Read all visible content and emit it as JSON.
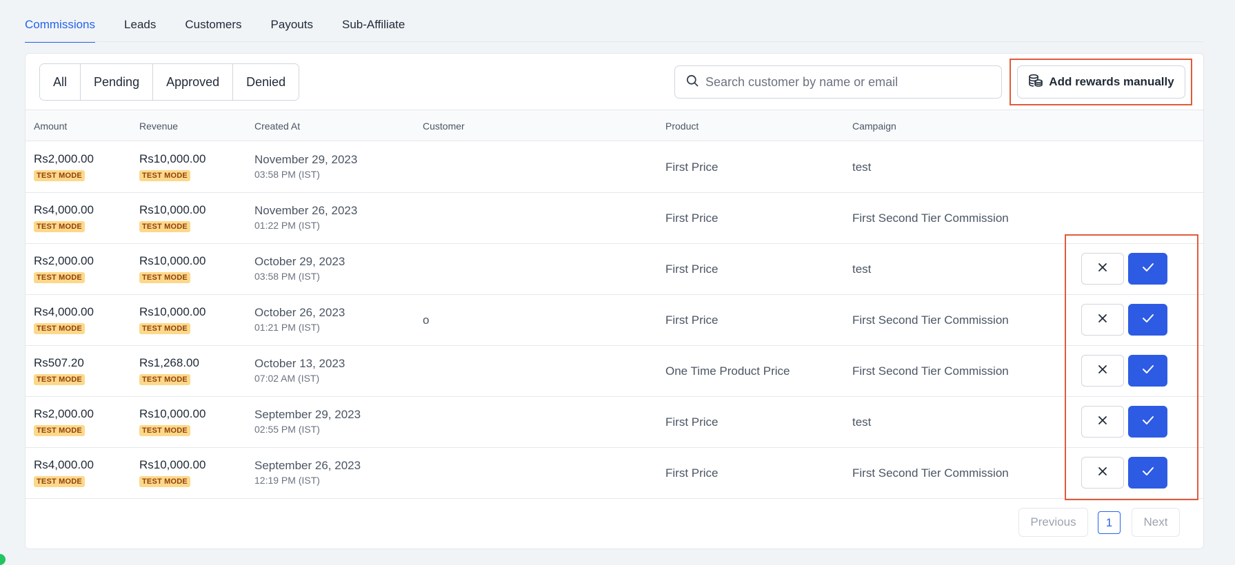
{
  "tabs": [
    {
      "label": "Commissions",
      "active": true
    },
    {
      "label": "Leads"
    },
    {
      "label": "Customers"
    },
    {
      "label": "Payouts"
    },
    {
      "label": "Sub-Affiliate"
    }
  ],
  "filters": [
    "All",
    "Pending",
    "Approved",
    "Denied"
  ],
  "search": {
    "placeholder": "Search customer by name or email",
    "icon": "search-icon"
  },
  "add_button": {
    "label": "Add rewards manually",
    "icon": "coins-stack-icon"
  },
  "columns": [
    "Amount",
    "Revenue",
    "Created At",
    "Customer",
    "Product",
    "Campaign"
  ],
  "badge_label": "TEST MODE",
  "rows": [
    {
      "amount": "Rs2,000.00",
      "revenue": "Rs10,000.00",
      "date": "November 29, 2023",
      "time": "03:58 PM (IST)",
      "customer": "",
      "product": "First Price",
      "campaign": "test",
      "actions": false
    },
    {
      "amount": "Rs4,000.00",
      "revenue": "Rs10,000.00",
      "date": "November 26, 2023",
      "time": "01:22 PM (IST)",
      "customer": "",
      "product": "First Price",
      "campaign": "First Second Tier Commission",
      "actions": false
    },
    {
      "amount": "Rs2,000.00",
      "revenue": "Rs10,000.00",
      "date": "October 29, 2023",
      "time": "03:58 PM (IST)",
      "customer": "",
      "product": "First Price",
      "campaign": "test",
      "actions": true
    },
    {
      "amount": "Rs4,000.00",
      "revenue": "Rs10,000.00",
      "date": "October 26, 2023",
      "time": "01:21 PM (IST)",
      "customer": "o",
      "product": "First Price",
      "campaign": "First Second Tier Commission",
      "actions": true
    },
    {
      "amount": "Rs507.20",
      "revenue": "Rs1,268.00",
      "date": "October 13, 2023",
      "time": "07:02 AM (IST)",
      "customer": "",
      "product": "One Time Product Price",
      "campaign": "First Second Tier Commission",
      "actions": true
    },
    {
      "amount": "Rs2,000.00",
      "revenue": "Rs10,000.00",
      "date": "September 29, 2023",
      "time": "02:55 PM (IST)",
      "customer": "",
      "product": "First Price",
      "campaign": "test",
      "actions": true
    },
    {
      "amount": "Rs4,000.00",
      "revenue": "Rs10,000.00",
      "date": "September 26, 2023",
      "time": "12:19 PM (IST)",
      "customer": "",
      "product": "First Price",
      "campaign": "First Second Tier Commission",
      "actions": true
    }
  ],
  "pagination": {
    "previous": "Previous",
    "current": "1",
    "next": "Next"
  },
  "colors": {
    "accent": "#2563eb",
    "approve": "#2d5be3",
    "highlight": "#e05a3a",
    "badge_bg": "#fcd98a",
    "badge_text": "#92400e"
  }
}
